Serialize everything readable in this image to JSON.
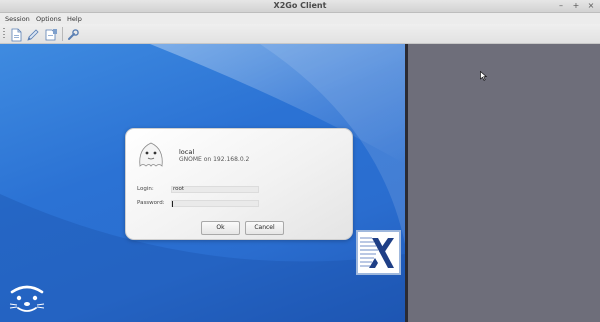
{
  "window": {
    "title": "X2Go Client",
    "controls": {
      "minimize": "–",
      "maximize": "+",
      "close": "×"
    }
  },
  "menubar": {
    "items": [
      "Session",
      "Options",
      "Help"
    ]
  },
  "toolbar": {
    "buttons": [
      {
        "icon": "new-session-icon"
      },
      {
        "icon": "edit-session-icon"
      },
      {
        "icon": "session-manager-icon"
      },
      {
        "icon": "settings-icon"
      }
    ]
  },
  "dialog": {
    "session_name": "local",
    "session_desc": "GNOME on 192.168.0.2",
    "login_label": "Login:",
    "login_value": "root",
    "password_label": "Password:",
    "password_value": "",
    "ok_label": "Ok",
    "cancel_label": "Cancel"
  },
  "colors": {
    "desktop_blue": "#2b72d4",
    "right_panel": "#6e6e7a"
  }
}
